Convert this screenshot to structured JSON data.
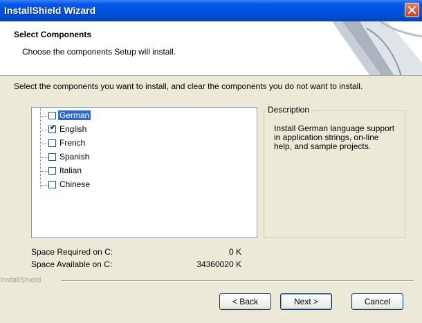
{
  "window": {
    "title": "InstallShield Wizard"
  },
  "header": {
    "title": "Select Components",
    "subtitle": "Choose the components Setup will install."
  },
  "instructions": "Select the components you want to install, and clear the components you do not want to install.",
  "components": [
    {
      "label": "German",
      "checked": false,
      "selected": true
    },
    {
      "label": "English",
      "checked": true,
      "selected": false
    },
    {
      "label": "French",
      "checked": false,
      "selected": false
    },
    {
      "label": "Spanish",
      "checked": false,
      "selected": false
    },
    {
      "label": "Italian",
      "checked": false,
      "selected": false
    },
    {
      "label": "Chinese",
      "checked": false,
      "selected": false
    }
  ],
  "description": {
    "legend": "Description",
    "text": "Install German language support in application strings, on-line help, and sample projects."
  },
  "space": {
    "required_label": "Space Required on  C:",
    "required_value": "0 K",
    "available_label": "Space Available on  C:",
    "available_value": "34360020 K"
  },
  "brand": "InstallShield",
  "buttons": {
    "back": "< Back",
    "next": "Next >",
    "cancel": "Cancel"
  },
  "colors": {
    "title_bar": "#0050d8",
    "selection": "#316ac5",
    "dialog_bg": "#ece9d8"
  }
}
